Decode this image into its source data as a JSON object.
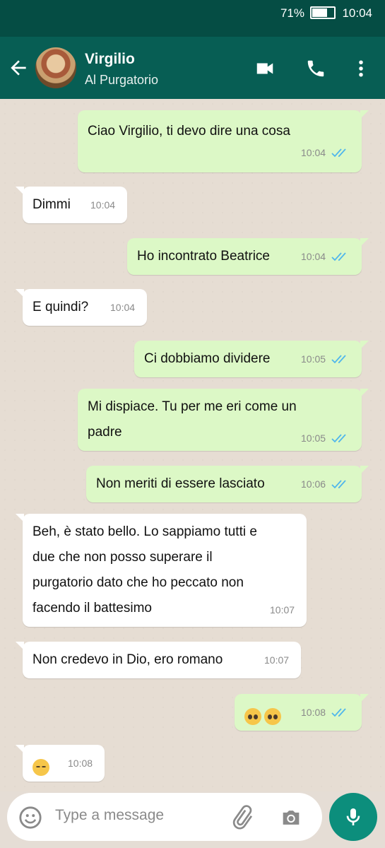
{
  "status_bar": {
    "battery_percent": "71%",
    "battery_level": 0.71,
    "time": "10:04"
  },
  "header": {
    "name": "Virgilio",
    "status": "Al Purgatorio"
  },
  "messages": [
    {
      "dir": "out",
      "lines": [
        "Ciao Virgilio, ti devo dire una cosa"
      ],
      "time": "10:04"
    },
    {
      "dir": "in",
      "lines": [
        "Dimmi"
      ],
      "time": "10:04"
    },
    {
      "dir": "out",
      "lines": [
        "Ho incontrato Beatrice"
      ],
      "time": "10:04"
    },
    {
      "dir": "in",
      "lines": [
        "E quindi?"
      ],
      "time": "10:04"
    },
    {
      "dir": "out",
      "lines": [
        "Ci dobbiamo dividere"
      ],
      "time": "10:05"
    },
    {
      "dir": "out",
      "lines": [
        "Mi dispiace. Tu per me eri come un",
        "padre"
      ],
      "time": "10:05"
    },
    {
      "dir": "out",
      "lines": [
        "Non meriti di essere lasciato"
      ],
      "time": "10:06"
    },
    {
      "dir": "in",
      "lines": [
        "Beh, è stato bello. Lo sappiamo tutti e",
        "due che non posso superare il",
        "purgatorio dato che ho peccato non",
        "facendo il battesimo"
      ],
      "time": "10:07"
    },
    {
      "dir": "in",
      "lines": [
        "Non credevo in Dio, ero romano"
      ],
      "time": "10:07"
    },
    {
      "dir": "out",
      "emoji": [
        "pleading-face-icon",
        "pleading-face-icon"
      ],
      "time": "10:08"
    },
    {
      "dir": "in",
      "emoji": [
        "pensive-face-icon"
      ],
      "time": "10:08"
    }
  ],
  "input": {
    "placeholder": "Type a message"
  },
  "colors": {
    "header": "#075e54",
    "status_bar": "#054d44",
    "outgoing": "#dcf8c6",
    "incoming": "#ffffff",
    "read_ticks": "#4fb6ec",
    "mic_button": "#0c8e7c"
  },
  "icons": [
    "back-arrow-icon",
    "video-call-icon",
    "phone-icon",
    "more-vert-icon",
    "emoji-icon",
    "attach-icon",
    "camera-icon",
    "mic-icon",
    "double-check-icon"
  ]
}
